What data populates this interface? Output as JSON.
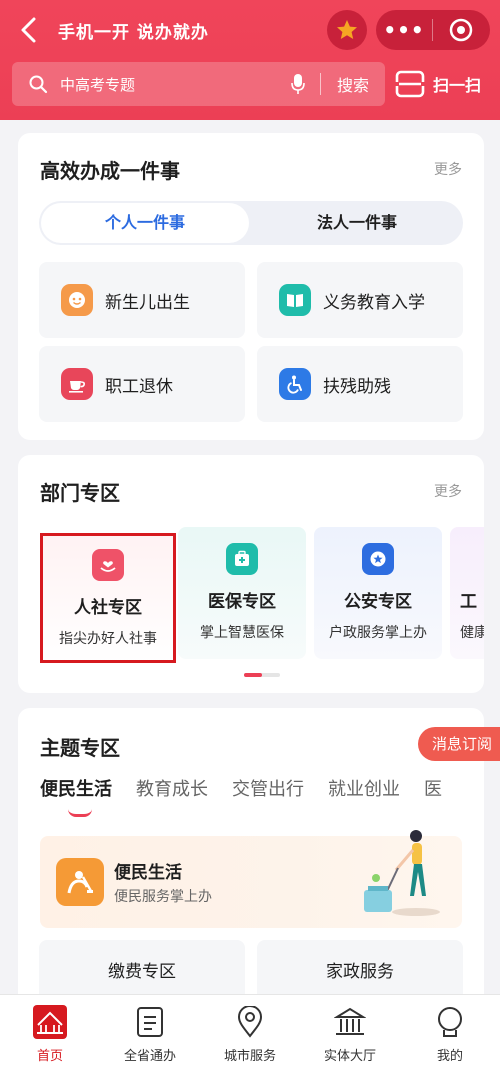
{
  "header": {
    "title": "手机一开 说办就办",
    "more": "•••",
    "search_placeholder": "中高考专题",
    "search_button": "搜索",
    "scan_label": "扫一扫"
  },
  "section1": {
    "title": "高效办成一件事",
    "more": "更多",
    "tabs": [
      "个人一件事",
      "法人一件事"
    ],
    "items": [
      {
        "label": "新生儿出生",
        "icon": "baby-face-icon",
        "color": "#f59a4a"
      },
      {
        "label": "义务教育入学",
        "icon": "book-icon",
        "color": "#1fbcaa"
      },
      {
        "label": "职工退休",
        "icon": "tea-cup-icon",
        "color": "#e8465a"
      },
      {
        "label": "扶残助残",
        "icon": "wheelchair-icon",
        "color": "#2d7ae6"
      }
    ]
  },
  "section2": {
    "title": "部门专区",
    "more": "更多",
    "items": [
      {
        "name": "人社专区",
        "sub": "指尖办好人社事",
        "icon": "heart-hand-icon",
        "color": "#ef5268"
      },
      {
        "name": "医保专区",
        "sub": "掌上智慧医保",
        "icon": "medical-kit-icon",
        "color": "#1fbcaa"
      },
      {
        "name": "公安专区",
        "sub": "户政服务掌上办",
        "icon": "police-badge-icon",
        "color": "#2d6de0"
      },
      {
        "name": "工",
        "sub": "健康",
        "icon": "",
        "color": "#a25ad0"
      }
    ]
  },
  "section3": {
    "title": "主题专区",
    "subscribe": "消息订阅",
    "tabs": [
      "便民生活",
      "教育成长",
      "交管出行",
      "就业创业",
      "医"
    ],
    "banner_title": "便民生活",
    "banner_sub": "便民服务掌上办",
    "services": [
      "缴费专区",
      "家政服务"
    ]
  },
  "nav": [
    {
      "label": "首页",
      "icon": "home-icon",
      "active": true
    },
    {
      "label": "全省通办",
      "icon": "document-icon",
      "active": false
    },
    {
      "label": "城市服务",
      "icon": "location-pin-icon",
      "active": false
    },
    {
      "label": "实体大厅",
      "icon": "building-icon",
      "active": false
    },
    {
      "label": "我的",
      "icon": "user-icon",
      "active": false
    }
  ],
  "colors": {
    "brand_red": "#ec3f55",
    "active_blue": "#2c6be0",
    "selection_outline": "#d6191f"
  }
}
